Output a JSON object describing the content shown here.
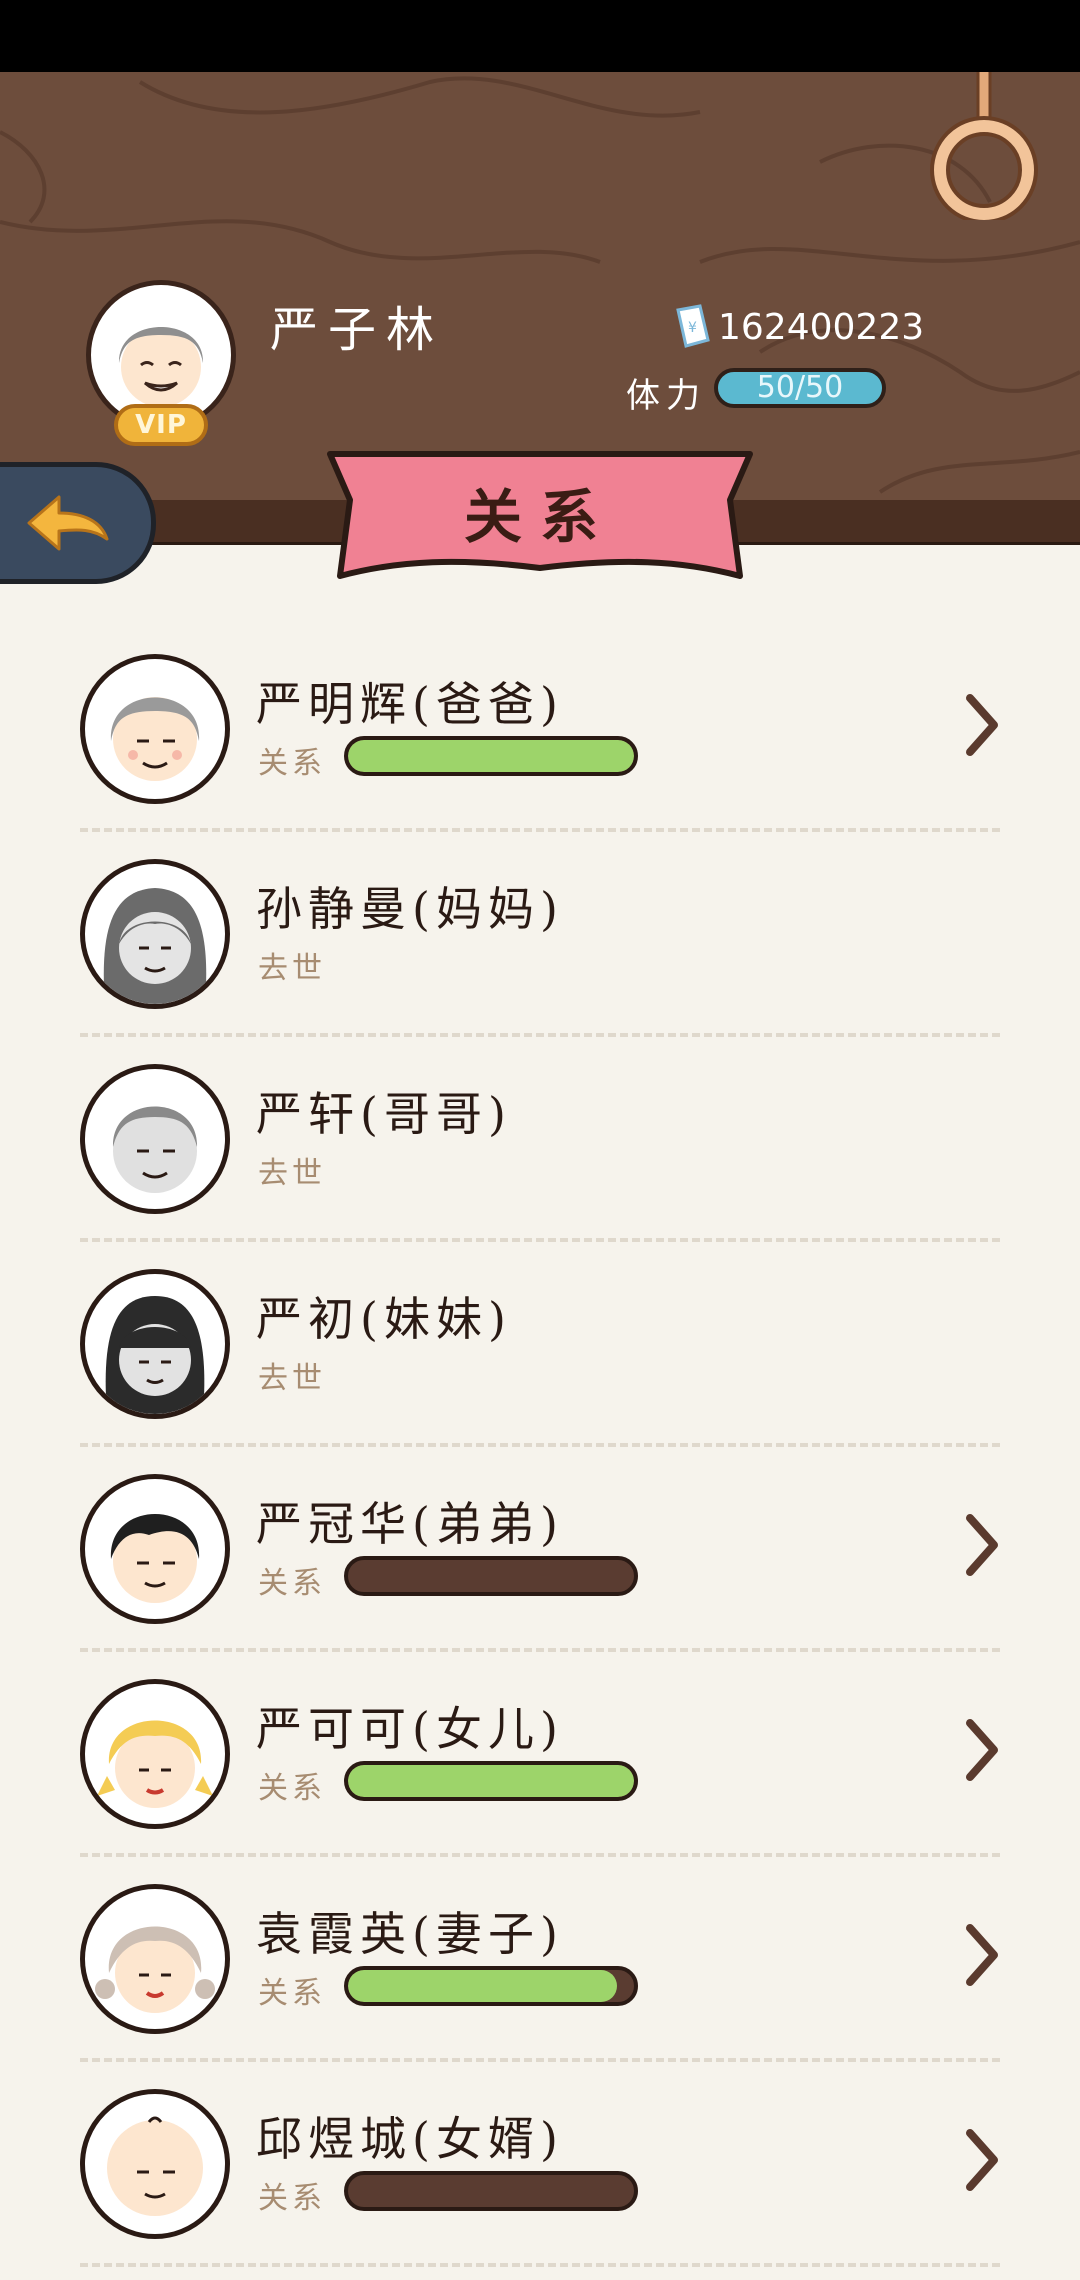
{
  "player": {
    "name": "严子林",
    "vip": "VIP",
    "coins": "162400223",
    "stamina_label": "体力",
    "stamina": "50/50"
  },
  "page_title": "关系",
  "icons": {
    "back": "back-arrow-icon",
    "money": "money-note-icon",
    "ring": "ring-icon",
    "chevron": "chevron-right-icon"
  },
  "colors": {
    "header_wood": "#6d4d3c",
    "banner": "#f08193",
    "relation_bar_fill": "#9dd46a",
    "relation_bar_empty": "#5a3c31",
    "stamina_bar": "#5bb9d0"
  },
  "relations": [
    {
      "name": "严明辉(爸爸)",
      "status": "关系",
      "bar": 1.0,
      "chevron": true
    },
    {
      "name": "孙静曼(妈妈)",
      "status": "去世",
      "bar": null,
      "chevron": false
    },
    {
      "name": "严轩(哥哥)",
      "status": "去世",
      "bar": null,
      "chevron": false
    },
    {
      "name": "严初(妹妹)",
      "status": "去世",
      "bar": null,
      "chevron": false
    },
    {
      "name": "严冠华(弟弟)",
      "status": "关系",
      "bar": 0.0,
      "chevron": true
    },
    {
      "name": "严可可(女儿)",
      "status": "关系",
      "bar": 1.0,
      "chevron": true
    },
    {
      "name": "袁霞英(妻子)",
      "status": "关系",
      "bar": 0.94,
      "chevron": true
    },
    {
      "name": "邱煜城(女婿)",
      "status": "关系",
      "bar": 0.0,
      "chevron": true
    }
  ]
}
